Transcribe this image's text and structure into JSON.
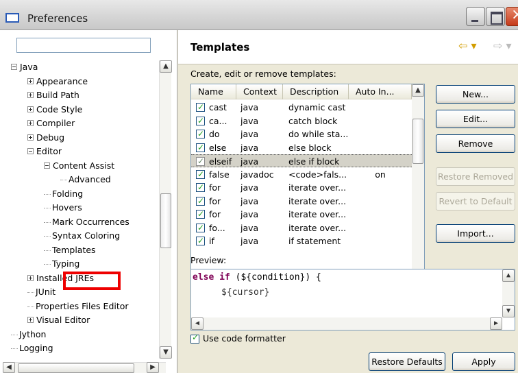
{
  "window": {
    "title": "Preferences"
  },
  "left": {
    "filter_value": "",
    "tree": [
      {
        "label": "Java",
        "indent": 0,
        "expander": "minus"
      },
      {
        "label": "Appearance",
        "indent": 1,
        "expander": "plus"
      },
      {
        "label": "Build Path",
        "indent": 1,
        "expander": "plus"
      },
      {
        "label": "Code Style",
        "indent": 1,
        "expander": "plus"
      },
      {
        "label": "Compiler",
        "indent": 1,
        "expander": "plus"
      },
      {
        "label": "Debug",
        "indent": 1,
        "expander": "plus"
      },
      {
        "label": "Editor",
        "indent": 1,
        "expander": "minus"
      },
      {
        "label": "Content Assist",
        "indent": 2,
        "expander": "minus"
      },
      {
        "label": "Advanced",
        "indent": 3,
        "expander": "none"
      },
      {
        "label": "Folding",
        "indent": 2,
        "expander": "none"
      },
      {
        "label": "Hovers",
        "indent": 2,
        "expander": "none"
      },
      {
        "label": "Mark Occurrences",
        "indent": 2,
        "expander": "none"
      },
      {
        "label": "Syntax Coloring",
        "indent": 2,
        "expander": "none"
      },
      {
        "label": "Templates",
        "indent": 2,
        "expander": "none"
      },
      {
        "label": "Typing",
        "indent": 2,
        "expander": "none"
      },
      {
        "label": "Installed JREs",
        "indent": 1,
        "expander": "plus"
      },
      {
        "label": "JUnit",
        "indent": 1,
        "expander": "none"
      },
      {
        "label": "Properties Files Editor",
        "indent": 1,
        "expander": "none"
      },
      {
        "label": "Visual Editor",
        "indent": 1,
        "expander": "plus"
      },
      {
        "label": "Jython",
        "indent": 0,
        "expander": "none"
      },
      {
        "label": "Logging",
        "indent": 0,
        "expander": "none"
      }
    ]
  },
  "right": {
    "title": "Templates",
    "subtitle": "Create, edit or remove templates:",
    "columns": [
      "Name",
      "Context",
      "Description",
      "Auto In..."
    ],
    "rows": [
      {
        "name": "cast",
        "context": "java",
        "description": "dynamic cast",
        "auto": ""
      },
      {
        "name": "ca...",
        "context": "java",
        "description": "catch block",
        "auto": ""
      },
      {
        "name": "do",
        "context": "java",
        "description": "do while sta...",
        "auto": ""
      },
      {
        "name": "else",
        "context": "java",
        "description": "else block",
        "auto": ""
      },
      {
        "name": "elseif",
        "context": "java",
        "description": "else if block",
        "auto": ""
      },
      {
        "name": "false",
        "context": "javadoc",
        "description": "<code>fals...",
        "auto": "on"
      },
      {
        "name": "for",
        "context": "java",
        "description": "iterate over...",
        "auto": ""
      },
      {
        "name": "for",
        "context": "java",
        "description": "iterate over...",
        "auto": ""
      },
      {
        "name": "for",
        "context": "java",
        "description": "iterate over...",
        "auto": ""
      },
      {
        "name": "fo...",
        "context": "java",
        "description": "iterate over...",
        "auto": ""
      },
      {
        "name": "if",
        "context": "java",
        "description": "if statement",
        "auto": ""
      }
    ],
    "buttons": {
      "new": "New...",
      "edit": "Edit...",
      "remove": "Remove",
      "restore_removed": "Restore Removed",
      "revert": "Revert to Default",
      "import": "Import..."
    },
    "preview_label": "Preview:",
    "code_keyword": "else if",
    "code_line1_rest": " (${condition}) {",
    "code_line2": "${cursor}",
    "formatter_label": "Use code formatter",
    "restore_defaults": "Restore Defaults",
    "apply": "Apply"
  }
}
